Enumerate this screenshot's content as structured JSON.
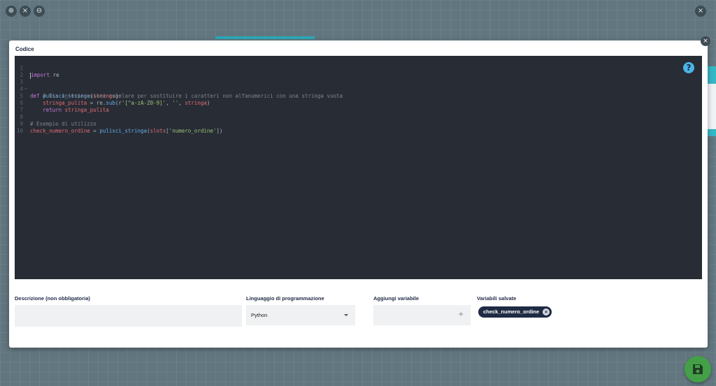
{
  "toolbar": {
    "zoom_in_icon": "zoom-in-icon",
    "reset_icon": "close-icon",
    "zoom_out_icon": "zoom-out-icon",
    "close_icon": "close-icon"
  },
  "modal": {
    "title": "Codice",
    "close_icon": "close-icon",
    "help_icon": "help-icon",
    "help_glyph": "?"
  },
  "editor": {
    "line_numbers": [
      "1",
      "2",
      "3",
      "4",
      "5",
      "6",
      "7",
      "8",
      "9",
      "10"
    ],
    "lines": [
      "import re",
      "",
      "def pulisci_stringa(stringa):",
      "    # Usa un'espressione regolare per sostituire i caratteri non alfanumerici con una stringa vuota",
      "    stringa_pulita = re.sub(r'[^a-zA-Z0-9]', '', stringa)",
      "    return stringa_pulita",
      "",
      "# Esempio di utilizzo",
      "check_numero_ordine = pulisci_stringa(slots['numero_ordine'])",
      ""
    ]
  },
  "form": {
    "description_label": "Descrizione (non obbligatoria)",
    "description_value": "",
    "language_label": "Linguaggio di programmazione",
    "language_value": "Python",
    "add_variable_label": "Aggiungi variabile",
    "add_variable_value": "",
    "add_icon_glyph": "+",
    "saved_variables_label": "Variabili salvate",
    "saved_variables": [
      "check_numero_ordine"
    ]
  },
  "colors": {
    "editor_bg": "#282c34",
    "chip_bg": "#1f2a44",
    "save_fab": "#43a047",
    "help_icon": "#4ab5e8"
  },
  "save_button_icon": "save-icon"
}
